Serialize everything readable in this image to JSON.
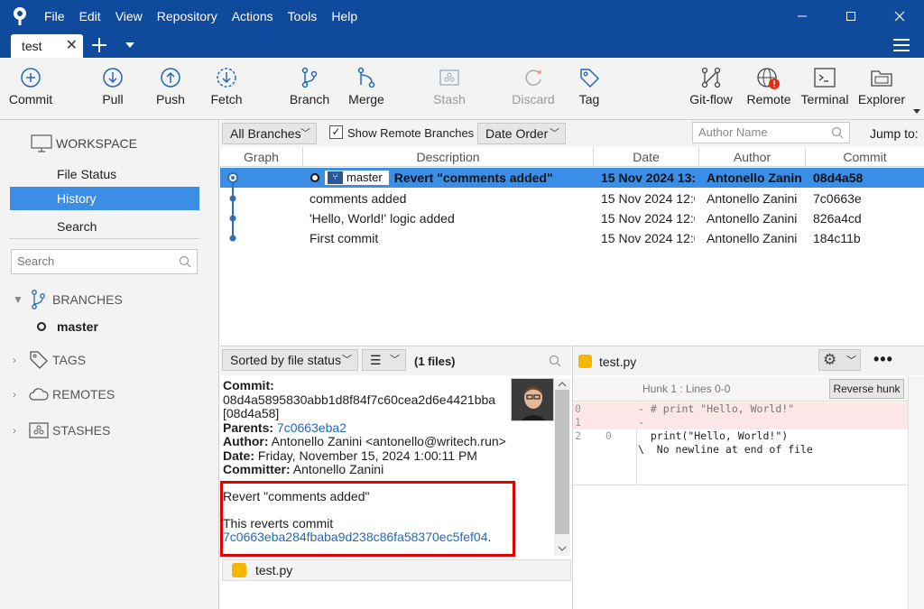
{
  "window": {
    "menu": [
      "File",
      "Edit",
      "View",
      "Repository",
      "Actions",
      "Tools",
      "Help"
    ],
    "tab_label": "test"
  },
  "toolbar": {
    "commit": "Commit",
    "pull": "Pull",
    "push": "Push",
    "fetch": "Fetch",
    "branch": "Branch",
    "merge": "Merge",
    "stash": "Stash",
    "discard": "Discard",
    "tag": "Tag",
    "gitflow": "Git-flow",
    "remote": "Remote",
    "terminal": "Terminal",
    "explorer": "Explorer"
  },
  "sidebar": {
    "workspace": "WORKSPACE",
    "items": [
      "File Status",
      "History",
      "Search"
    ],
    "active_item": "History",
    "search_placeholder": "Search",
    "branches": "BRANCHES",
    "current_branch": "master",
    "tags": "TAGS",
    "remotes": "REMOTES",
    "stashes": "STASHES"
  },
  "grid_toolbar": {
    "branch_filter": "All Branches",
    "show_remote": "Show Remote Branches",
    "show_remote_checked": true,
    "order": "Date Order",
    "author_placeholder": "Author Name",
    "jump_to": "Jump to:"
  },
  "columns": [
    "Graph",
    "Description",
    "Date",
    "Author",
    "Commit"
  ],
  "commits": [
    {
      "description": "Revert \"comments added\"",
      "branch": "master",
      "date": "15 Nov 2024 13:",
      "author": "Antonello Zanin",
      "hash": "08d4a58"
    },
    {
      "description": "comments added",
      "date": "15 Nov 2024 12:0",
      "author": "Antonello Zanini",
      "hash": "7c0663e"
    },
    {
      "description": "'Hello, World!' logic added",
      "date": "15 Nov 2024 12:0",
      "author": "Antonello Zanini",
      "hash": "826a4cd"
    },
    {
      "description": "First commit",
      "date": "15 Nov 2024 12:0",
      "author": "Antonello Zanini",
      "hash": "184c11b"
    }
  ],
  "details": {
    "sort_label": "Sorted by file status",
    "files_count": "(1 files)",
    "commit_label": "Commit:",
    "commit_full": "08d4a5895830abb1d8f84f7c60cea2d6e4421bba",
    "commit_short": "[08d4a58]",
    "parents_label": "Parents:",
    "parents": "7c0663eba2",
    "author_label": "Author:",
    "author": "Antonello Zanini <antonello@writech.run>",
    "date_label": "Date:",
    "date": "Friday, November 15, 2024 1:00:11 PM",
    "committer_label": "Committer:",
    "committer": "Antonello Zanini",
    "message_title": "Revert \"comments added\"",
    "message_body": "This reverts commit",
    "reverted_hash": "7c0663eba284fbaba9d238c86fa58370ec5fef04",
    "message_end": ".",
    "file": "test.py"
  },
  "diff": {
    "file": "test.py",
    "hunk": "Hunk 1 : Lines 0-0",
    "reverse_hunk": "Reverse hunk",
    "lines": [
      {
        "old": "0",
        "new": "",
        "text": "- # print \"Hello, World!\"",
        "type": "removed"
      },
      {
        "old": "1",
        "new": "",
        "text": "-",
        "type": "removed"
      },
      {
        "old": "2",
        "new": "0",
        "text": "  print(\"Hello, World!\")",
        "type": "context"
      },
      {
        "old": "",
        "new": "",
        "text": "\\  No newline at end of file",
        "type": "context"
      }
    ]
  },
  "colors": {
    "titlebar": "#0f4a9c",
    "selection": "#3a8ee6",
    "highlight_box": "#e00000",
    "link": "#2368b8"
  }
}
